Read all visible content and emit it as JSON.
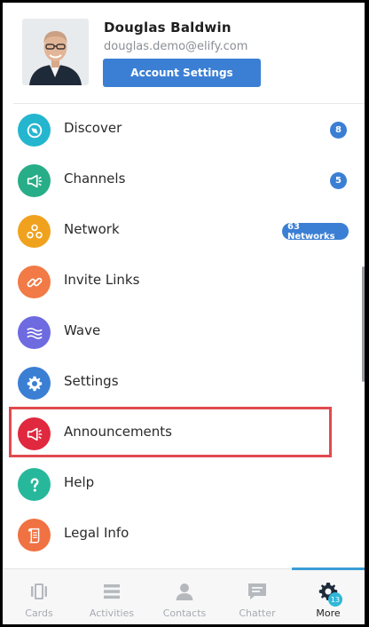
{
  "profile": {
    "name": "Douglas Baldwin",
    "email": "douglas.demo@elify.com",
    "account_button": "Account Settings"
  },
  "menu": [
    {
      "label": "Discover",
      "icon": "compass-icon",
      "color": "#24b6cf",
      "badge": "8"
    },
    {
      "label": "Channels",
      "icon": "megaphone-icon",
      "color": "#27ad87",
      "badge": "5"
    },
    {
      "label": "Network",
      "icon": "network-icon",
      "color": "#f0a21e",
      "badge": "63 Networks"
    },
    {
      "label": "Invite Links",
      "icon": "link-icon",
      "color": "#f27a46",
      "badge": ""
    },
    {
      "label": "Wave",
      "icon": "wave-icon",
      "color": "#6e6ae0",
      "badge": ""
    },
    {
      "label": "Settings",
      "icon": "gear-icon",
      "color": "#3b7fd4",
      "badge": ""
    },
    {
      "label": "Announcements",
      "icon": "megaphone-icon",
      "color": "#e0283f",
      "badge": ""
    },
    {
      "label": "Help",
      "icon": "question-icon",
      "color": "#27b89c",
      "badge": ""
    },
    {
      "label": "Legal Info",
      "icon": "scroll-icon",
      "color": "#f07142",
      "badge": ""
    }
  ],
  "tabs": [
    {
      "label": "Cards",
      "icon": "cards-icon"
    },
    {
      "label": "Activities",
      "icon": "activities-icon"
    },
    {
      "label": "Contacts",
      "icon": "contacts-icon"
    },
    {
      "label": "Chatter",
      "icon": "chatter-icon"
    },
    {
      "label": "More",
      "icon": "gear-icon",
      "badge": "13",
      "active": true
    }
  ],
  "colors": {
    "accent": "#3b7fd4",
    "highlight": "#e04a4f"
  }
}
